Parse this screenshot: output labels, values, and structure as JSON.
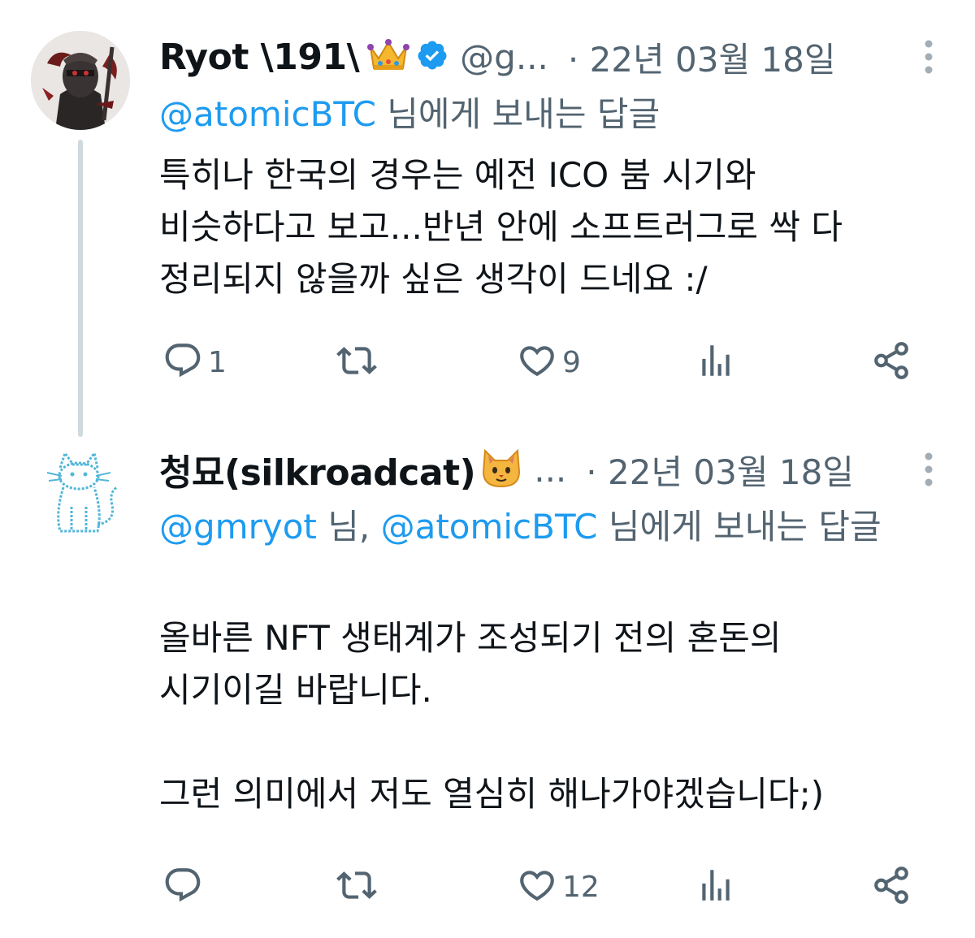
{
  "tweets": [
    {
      "name": "Ryot \\191\\",
      "name_emoji": "👑",
      "handle": "@g...",
      "time": "· 22년 03월 18일",
      "reply_prefix": "",
      "reply_mentions": [
        "@atomicBTC"
      ],
      "reply_suffix": " 님에게 보내는 답글",
      "body_lines": [
        "특히나 한국의 경우는 예전 ICO 붐 시기와",
        "비슷하다고 보고...반년 안에 소프트러그로 싹 다",
        "정리되지 않을까 싶은 생각이 드네요 :/"
      ],
      "reply_count": "1",
      "retweet_count": "",
      "like_count": "9"
    },
    {
      "name": "청묘(silkroadcat)",
      "name_emoji": "🐱",
      "handle": "...",
      "time": "· 22년 03월 18일",
      "reply_mentions": [
        "@gmryot",
        "@atomicBTC"
      ],
      "reply_mid": " 님, ",
      "reply_suffix": " 님에게 보내는 답글",
      "body_paragraph1": [
        "올바른 NFT 생태계가 조성되기 전의 혼돈의",
        "시기이길 바랍니다."
      ],
      "body_paragraph2": "그런 의미에서 저도 열심히 해나가야겠습니다;)",
      "reply_count": "",
      "retweet_count": "",
      "like_count": "12"
    }
  ],
  "icons": {
    "verified": "verified-badge-icon",
    "more": "more-dots-icon",
    "reply": "reply-bubble-icon",
    "retweet": "retweet-icon",
    "like": "heart-icon",
    "views": "views-bar-chart-icon",
    "share": "share-icon"
  },
  "colors": {
    "accent": "#1d9bf0",
    "secondary_text": "#536471",
    "primary_text": "#0f1419",
    "thread_line": "#cfd9de",
    "cat_outline": "#52b6d8"
  }
}
